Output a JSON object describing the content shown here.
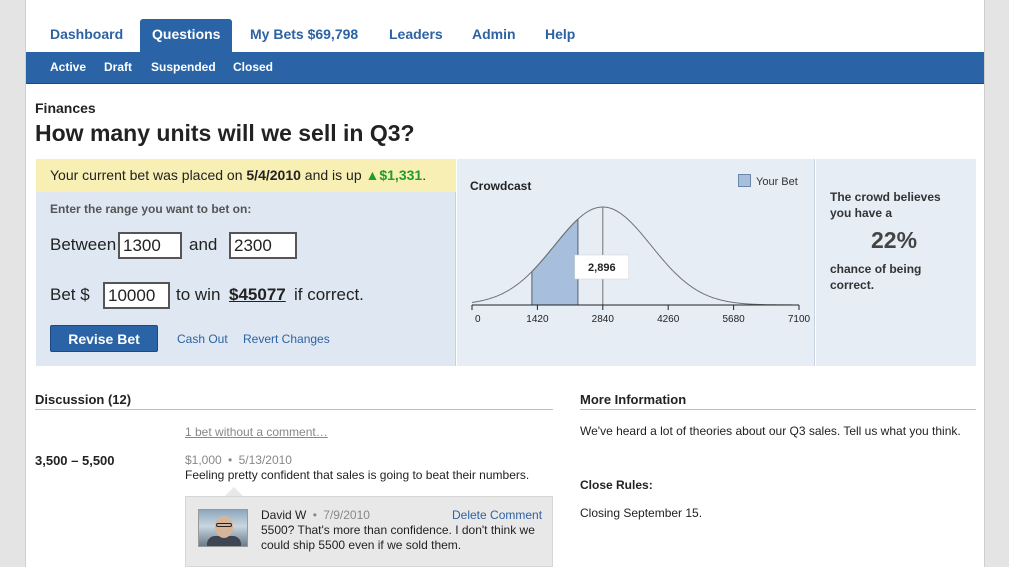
{
  "tabs": [
    {
      "label": "Dashboard"
    },
    {
      "label": "Questions"
    },
    {
      "label": "My Bets $69,798"
    },
    {
      "label": "Leaders"
    },
    {
      "label": "Admin"
    },
    {
      "label": "Help"
    }
  ],
  "active_tab": "Questions",
  "subnav": [
    "Active",
    "Draft",
    "Suspended",
    "Closed"
  ],
  "question": {
    "category": "Finances",
    "title": "How many units will we sell in Q3?"
  },
  "bet": {
    "notice_prefix": "Your current bet was placed on",
    "placed_date": "5/4/2010",
    "notice_mid": "and is up",
    "gain": "▲$1,331",
    "notice_end": ".",
    "range_prompt": "Enter the range you want to bet on:",
    "between_label": "Between",
    "low": "1300",
    "and_label": "and",
    "high": "2300",
    "bet_label": "Bet $",
    "amount": "10000",
    "to_win_label": "to win",
    "win_amount": "$45077",
    "if_correct_label": "if correct.",
    "revise_button": "Revise Bet",
    "cash_out": "Cash Out",
    "revert": "Revert Changes"
  },
  "chart_data": {
    "type": "area",
    "title": "Crowdcast",
    "legend": [
      "Your Bet"
    ],
    "legend_position": "top-right",
    "x_ticks": [
      "0",
      "1420",
      "2840",
      "4260",
      "5680",
      "7100"
    ],
    "xlim": [
      0,
      7100
    ],
    "distribution": "normal",
    "mean": 2840,
    "std": 1050,
    "marker_value": "2,896",
    "shaded_range": [
      1300,
      2300
    ]
  },
  "odds": {
    "line1": "The crowd believes you have a",
    "value": "22%",
    "line2": "chance of being correct."
  },
  "discussion": {
    "heading": "Discussion (12)",
    "no_comment_link": "1 bet without a comment…",
    "range": "3,500 – 5,500",
    "bet_amount": "$1,000",
    "bullet": "•",
    "bet_date": "5/13/2010",
    "bet_comment": "Feeling pretty confident that sales is going to beat their numbers.",
    "reply": {
      "author": "David W",
      "date": "7/9/2010",
      "delete_label": "Delete Comment",
      "text_line1": "5500? That's more than confidence. I don't think we",
      "text_line2": "could ship 5500 even if we sold them."
    }
  },
  "more_info": {
    "heading": "More Information",
    "text": "We've heard a lot of theories about our Q3 sales. Tell us what you think.",
    "close_rules_label": "Close Rules:",
    "close_rules": "Closing September 15."
  },
  "colors": {
    "brand_blue": "#2a64a6",
    "notice_yellow": "#f7efb4",
    "gain_green": "#1f9d2a",
    "panel_blue": "#dfe8f2",
    "bet_fill": "#a7bedd"
  }
}
